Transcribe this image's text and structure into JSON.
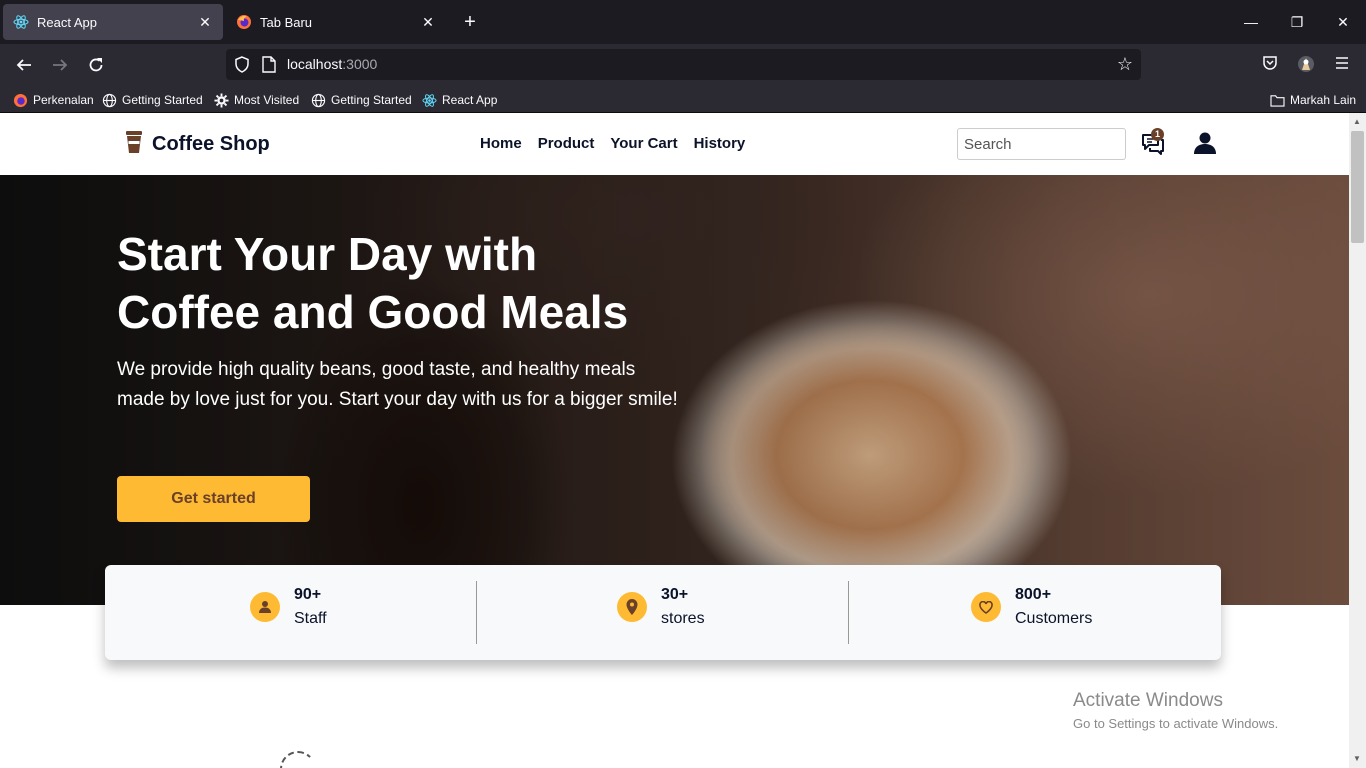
{
  "browser": {
    "tabs": [
      {
        "title": "React App",
        "active": true
      },
      {
        "title": "Tab Baru",
        "active": false
      }
    ],
    "url_host": "localhost",
    "url_port": ":3000",
    "bookmarks": [
      "Perkenalan",
      "Getting Started",
      "Most Visited",
      "Getting Started",
      "React App"
    ],
    "other_bookmarks": "Markah Lain"
  },
  "site": {
    "brand": "Coffee Shop",
    "nav": [
      "Home",
      "Product",
      "Your Cart",
      "History"
    ],
    "search_placeholder": "Search",
    "notification_count": "1"
  },
  "hero": {
    "title_line1": "Start Your Day with",
    "title_line2": "Coffee and Good Meals",
    "description": "We provide high quality beans, good taste, and healthy meals made by love just for you. Start your day with us for a bigger smile!",
    "cta": "Get started"
  },
  "stats": [
    {
      "value": "90+",
      "label": "Staff",
      "icon": "person-icon"
    },
    {
      "value": "30+",
      "label": "stores",
      "icon": "location-pin-icon"
    },
    {
      "value": "800+",
      "label": "Customers",
      "icon": "heart-icon"
    }
  ],
  "watermark": {
    "title": "Activate Windows",
    "subtitle": "Go to Settings to activate Windows."
  },
  "colors": {
    "accent": "#ffba33",
    "brown": "#6a4029",
    "dark_text": "#0b132a"
  }
}
